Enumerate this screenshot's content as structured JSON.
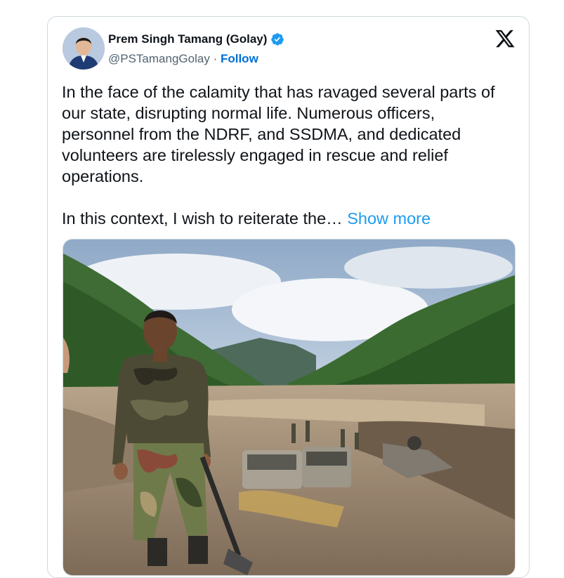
{
  "author": {
    "name": "Prem Singh Tamang (Golay)",
    "handle": "@PSTamangGolay",
    "separator": "·",
    "follow_label": "Follow",
    "verified": true
  },
  "post": {
    "paragraph_1": "In the face of the calamity that has ravaged several parts of our state, disrupting normal life. Numerous officers, personnel from the NDRF, and SSDMA, and dedicated volunteers are tirelessly engaged in rescue and relief operations.",
    "paragraph_2_prefix": "In this context, I wish to reiterate the…",
    "show_more_label": "Show more"
  },
  "icons": {
    "brand": "x-logo-icon",
    "verified": "verified-badge-icon"
  },
  "colors": {
    "link": "#1d9bf0",
    "follow": "#006fd6",
    "verified": "#1d9bf0",
    "border": "#cfd9de"
  }
}
